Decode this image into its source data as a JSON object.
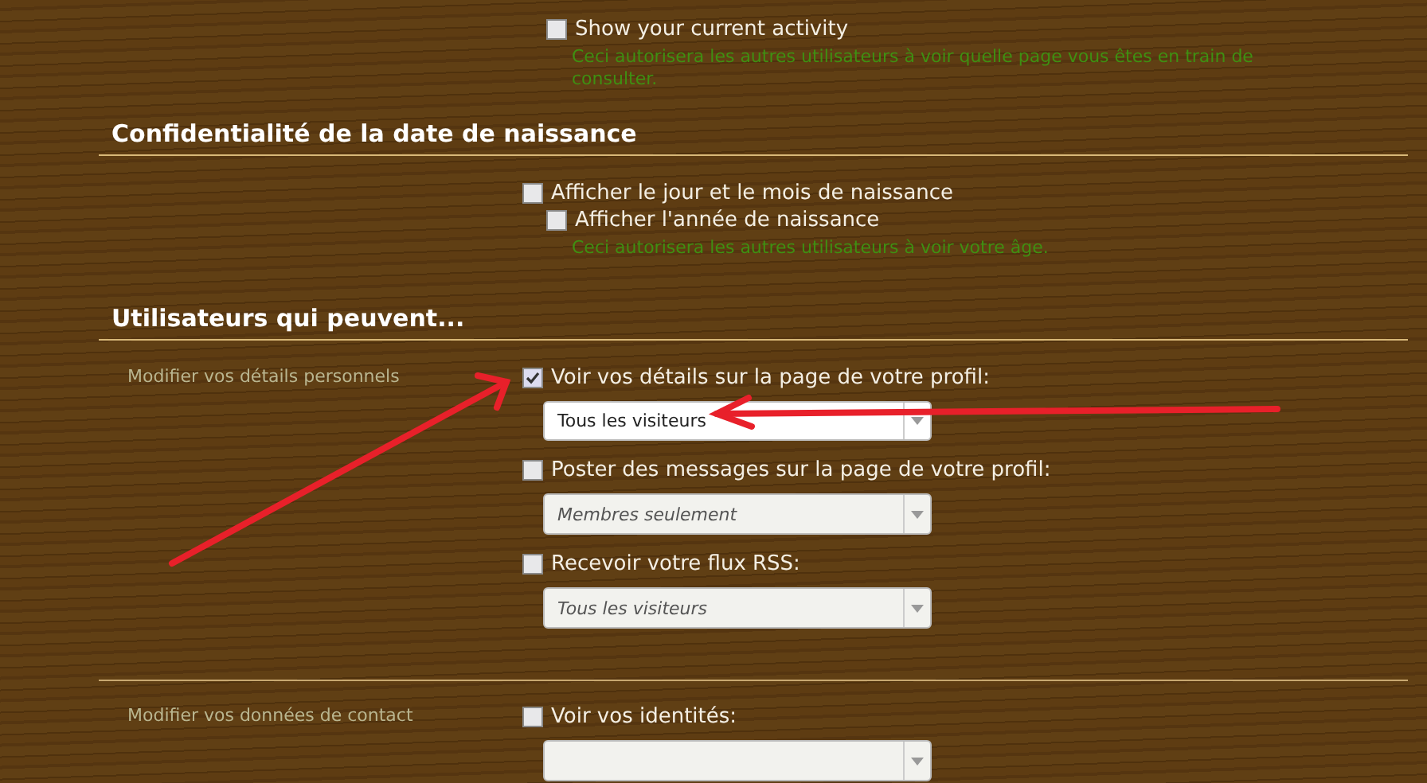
{
  "activity": {
    "label": "Show your current activity",
    "checked": false,
    "hint": "Ceci autorisera les autres utilisateurs à voir quelle page vous êtes en train de consulter."
  },
  "sections": [
    {
      "title": "Confidentialité de la date de naissance",
      "groups": [
        {
          "options": [
            {
              "label": "Afficher le jour et le mois de naissance",
              "checked": false,
              "children": [
                {
                  "label": "Afficher l'année de naissance",
                  "checked": false,
                  "hint": "Ceci autorisera les autres utilisateurs à voir votre âge."
                }
              ]
            }
          ]
        }
      ]
    },
    {
      "title": "Utilisateurs qui peuvent...",
      "groups": [
        {
          "label": "Modifier vos détails personnels",
          "options": [
            {
              "label": "Voir vos détails sur la page de votre profil:",
              "checked": true,
              "select": {
                "value": "Tous les visiteurs",
                "disabled": false
              }
            },
            {
              "label": "Poster des messages sur la page de votre profil:",
              "checked": false,
              "select": {
                "value": "Membres seulement",
                "disabled": true
              }
            },
            {
              "label": "Recevoir votre flux RSS:",
              "checked": false,
              "select": {
                "value": "Tous les visiteurs",
                "disabled": true
              }
            }
          ]
        },
        {
          "label": "Modifier vos données de contact",
          "options": [
            {
              "label": "Voir vos identités:",
              "checked": false,
              "select": {
                "disabled": true
              }
            }
          ]
        }
      ]
    }
  ]
}
